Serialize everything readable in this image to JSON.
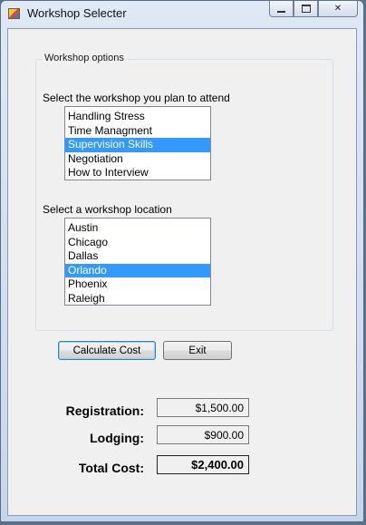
{
  "window": {
    "title": "Workshop Selecter",
    "icon": "app-icon"
  },
  "group": {
    "legend": "Workshop options",
    "workshop_prompt": "Select the workshop you plan to attend",
    "workshops": [
      {
        "label": "Handling Stress",
        "selected": false
      },
      {
        "label": "Time Managment",
        "selected": false
      },
      {
        "label": "Supervision Skills",
        "selected": true
      },
      {
        "label": "Negotiation",
        "selected": false
      },
      {
        "label": "How to Interview",
        "selected": false
      }
    ],
    "location_prompt": "Select a workshop location",
    "locations": [
      {
        "label": "Austin",
        "selected": false
      },
      {
        "label": "Chicago",
        "selected": false
      },
      {
        "label": "Dallas",
        "selected": false
      },
      {
        "label": "Orlando",
        "selected": true
      },
      {
        "label": "Phoenix",
        "selected": false
      },
      {
        "label": "Raleigh",
        "selected": false
      }
    ]
  },
  "buttons": {
    "calculate": "Calculate Cost",
    "exit": "Exit"
  },
  "results": {
    "registration_label": "Registration:",
    "registration_value": "$1,500.00",
    "lodging_label": "Lodging:",
    "lodging_value": "$900.00",
    "total_label": "Total Cost:",
    "total_value": "$2,400.00"
  },
  "colors": {
    "selection": "#3399ff",
    "titlebar": "#dfe9f5"
  }
}
